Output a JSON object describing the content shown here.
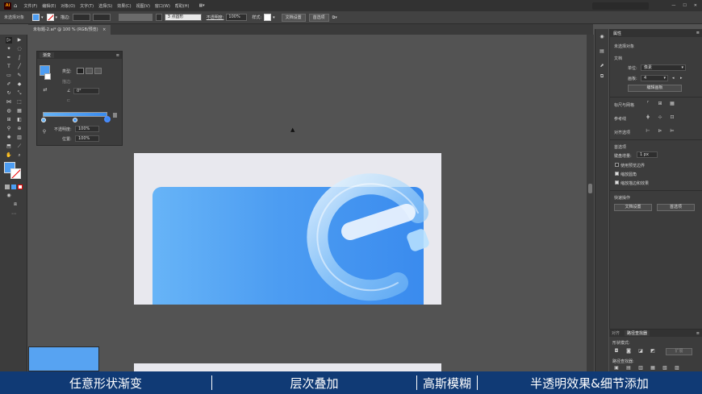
{
  "menu": {
    "logo": "Ai",
    "items": [
      "文件(F)",
      "编辑(E)",
      "对象(O)",
      "文字(T)",
      "选择(S)",
      "效果(C)",
      "视图(V)",
      "窗口(W)",
      "帮助(H)"
    ]
  },
  "control": {
    "selection": "未选择对象",
    "stroke_label": "描边:",
    "point_label": "3 点圆形",
    "opacity_label": "不透明度:",
    "opacity_value": "100%",
    "style_label": "样式:",
    "doc_setup": "文档设置",
    "prefs": "首选项"
  },
  "tab": {
    "title": "未标题-2.ai* @ 100 % (RGB/预览)",
    "close": "×"
  },
  "gradient_panel": {
    "title": "渐变",
    "type_label": "类型:",
    "stroke_label": "描边:",
    "angle_value": "0°",
    "opacity_label": "不透明度:",
    "opacity_value": "100%",
    "position_label": "位置:",
    "position_value": "100%"
  },
  "properties": {
    "tab": "属性",
    "no_selection": "未选择对象",
    "document": "文档",
    "unit_label": "单位:",
    "unit_value": "像素",
    "artboard_label": "画板:",
    "artboard_value": "4",
    "edit_artboard": "编辑画板",
    "ruler_grid": "标尺与网格",
    "guides": "参考线",
    "snap": "对齐选项",
    "prefs_section": "首选项",
    "key_increment_label": "键盘增量:",
    "key_increment_value": "1 px",
    "use_preview_bounds": "使用预览边界",
    "scale_corners": "缩放圆角",
    "scale_strokes": "缩放描边和效果",
    "quick_actions": "快速操作",
    "doc_setup_btn": "文档设置",
    "prefs_btn": "首选项"
  },
  "pathfinder": {
    "tab_align": "对齐",
    "tab_pathfinder": "路径查找器",
    "shape_modes": "形状模式:",
    "pathfinders": "路径查找器:",
    "expand": "扩展"
  },
  "caption": {
    "seg1": "任意形状渐变",
    "seg2": "层次叠加",
    "seg3": "高斯模糊",
    "seg4": "半透明效果&细节添加"
  },
  "colors": {
    "accent": "#4d9df2",
    "card_light": "#67b4f7",
    "card_dark": "#3a8bee",
    "caption_bg": "#103a75"
  }
}
